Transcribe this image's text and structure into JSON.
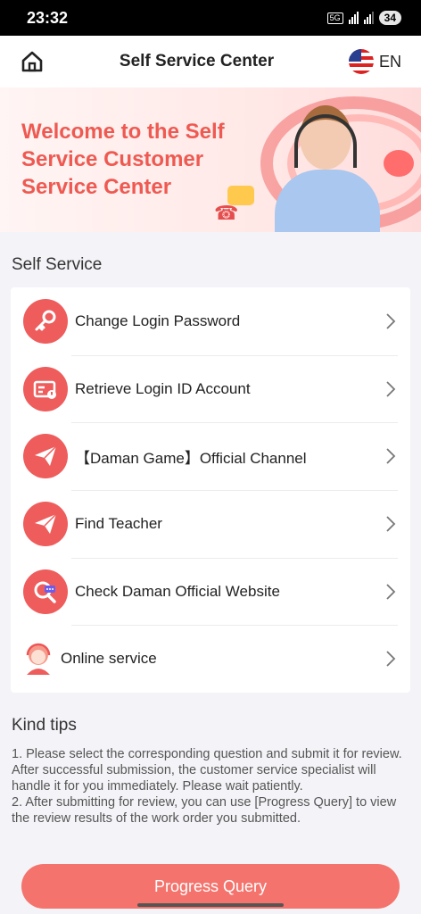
{
  "status": {
    "time": "23:32",
    "network": "5G",
    "battery": "34"
  },
  "header": {
    "title": "Self Service Center",
    "lang": "EN",
    "home_icon": "home-icon",
    "flag_icon": "us-flag-icon"
  },
  "banner": {
    "line1": "Welcome to the Self",
    "line2": "Service Customer",
    "line3": "Service Center"
  },
  "self_service": {
    "title": "Self Service",
    "items": [
      {
        "label": "Change Login Password",
        "icon": "key-icon"
      },
      {
        "label": "Retrieve Login ID Account",
        "icon": "id-card-icon"
      },
      {
        "label": "【Daman Game】Official Channel",
        "icon": "paper-plane-icon"
      },
      {
        "label": "Find Teacher",
        "icon": "paper-plane-icon"
      },
      {
        "label": "Check Daman Official Website",
        "icon": "search-chat-icon"
      },
      {
        "label": "Online service",
        "icon": "support-agent-icon"
      }
    ]
  },
  "tips": {
    "title": "Kind tips",
    "line1": "1. Please select the corresponding question and submit it for review. After successful submission, the customer service specialist will handle it for you immediately. Please wait patiently.",
    "line2": "2. After submitting for review, you can use [Progress Query] to view the review results of the work order you submitted."
  },
  "footer": {
    "button_label": "Progress Query"
  },
  "colors": {
    "accent": "#ef5c5c",
    "button": "#f4746d",
    "banner_text": "#ee5a52"
  }
}
